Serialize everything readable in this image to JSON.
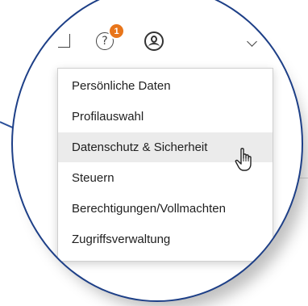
{
  "topbar": {
    "notification_count": "1",
    "help_glyph": "?",
    "icons": [
      "box-icon",
      "help-icon",
      "user-icon",
      "chevron-down-icon"
    ]
  },
  "menu": {
    "items": [
      {
        "label": "Persönliche Daten"
      },
      {
        "label": "Profilauswahl"
      },
      {
        "label": "Datenschutz & Sicherheit",
        "state": "hover"
      },
      {
        "label": "Steuern"
      },
      {
        "label": "Berechtigungen/Vollmachten"
      },
      {
        "label": "Zugriffsverwaltung"
      }
    ]
  },
  "colors": {
    "badge": "#e8751a",
    "lens_border": "#1d3f87",
    "hover_bg": "#ebebeb"
  }
}
